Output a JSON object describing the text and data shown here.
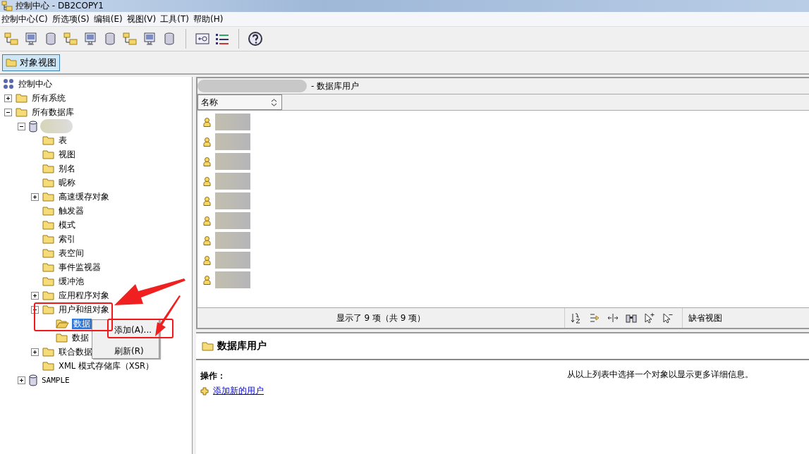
{
  "window": {
    "title": "控制中心 - DB2COPY1"
  },
  "menu": [
    "控制中心(C)",
    "所选项(S)",
    "编辑(E)",
    "视图(V)",
    "工具(T)",
    "帮助(H)"
  ],
  "view_tabs": [
    {
      "label": "对象视图",
      "selected": true
    }
  ],
  "tree": [
    {
      "kind": "root",
      "label": "控制中心",
      "children": [
        {
          "kind": "folder",
          "label": "所有系统",
          "expanded": false
        },
        {
          "kind": "folder",
          "label": "所有数据库",
          "expanded": true,
          "children": [
            {
              "kind": "database",
              "expanded": true,
              "children": [
                {
                  "kind": "folder",
                  "label": "表"
                },
                {
                  "kind": "folder",
                  "label": "视图"
                },
                {
                  "kind": "folder",
                  "label": "别名"
                },
                {
                  "kind": "folder",
                  "label": "昵称"
                },
                {
                  "kind": "folder",
                  "label": "高速缓存对象",
                  "expanded": false
                },
                {
                  "kind": "folder",
                  "label": "触发器"
                },
                {
                  "kind": "folder",
                  "label": "模式"
                },
                {
                  "kind": "folder",
                  "label": "索引"
                },
                {
                  "kind": "folder",
                  "label": "表空间"
                },
                {
                  "kind": "folder",
                  "label": "事件监视器"
                },
                {
                  "kind": "folder",
                  "label": "缓冲池"
                },
                {
                  "kind": "folder",
                  "label": "应用程序对象",
                  "expanded": false
                },
                {
                  "kind": "folder",
                  "label": "用户和组对象",
                  "expanded": true,
                  "children": [
                    {
                      "kind": "open-folder",
                      "label": "数据",
                      "selected": true
                    },
                    {
                      "kind": "folder",
                      "label": "数据"
                    }
                  ]
                },
                {
                  "kind": "folder",
                  "label": "联合数据",
                  "expanded": false
                },
                {
                  "kind": "folder",
                  "label": "XML 模式存储库（XSR）"
                }
              ]
            },
            {
              "kind": "database",
              "label": "SAMPLE",
              "expanded": false
            }
          ]
        }
      ]
    }
  ],
  "context_menu": [
    "添加(A)...",
    "刷新(R)"
  ],
  "list": {
    "title": "- 数据库用户",
    "columns": [
      "名称"
    ],
    "rows": [
      {
        "kind": "user"
      },
      {
        "kind": "user"
      },
      {
        "kind": "user"
      },
      {
        "kind": "user"
      },
      {
        "kind": "user"
      },
      {
        "kind": "user"
      },
      {
        "kind": "user"
      },
      {
        "kind": "user"
      },
      {
        "kind": "user"
      }
    ],
    "status": "显示了 9 项（共 9 项）",
    "view": "缺省视图"
  },
  "details": {
    "title": "数据库用户",
    "actions_label": "操作：",
    "actions": [
      "添加新的用户"
    ],
    "hint": "从以上列表中选择一个对象以显示更多详细信息。"
  }
}
